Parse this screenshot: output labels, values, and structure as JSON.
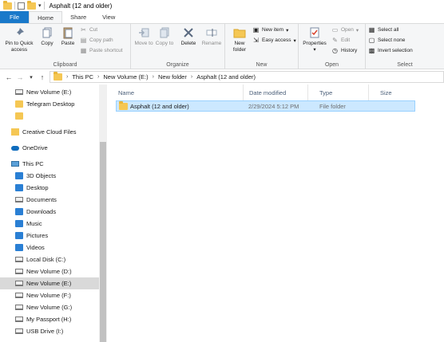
{
  "window": {
    "title": "Asphalt (12 and older)"
  },
  "tabs": [
    "File",
    "Home",
    "Share",
    "View"
  ],
  "ribbon": {
    "clipboard": {
      "label": "Clipboard",
      "pin": "Pin to Quick access",
      "copy": "Copy",
      "paste": "Paste",
      "cut": "Cut",
      "copy_path": "Copy path",
      "paste_shortcut": "Paste shortcut"
    },
    "organize": {
      "label": "Organize",
      "move_to": "Move to",
      "copy_to": "Copy to",
      "delete": "Delete",
      "rename": "Rename"
    },
    "new": {
      "label": "New",
      "new_folder": "New folder",
      "new_item": "New item",
      "easy_access": "Easy access"
    },
    "open": {
      "label": "Open",
      "properties": "Properties",
      "open": "Open",
      "edit": "Edit",
      "history": "History"
    },
    "select": {
      "label": "Select",
      "select_all": "Select all",
      "select_none": "Select none",
      "invert": "Invert selection"
    }
  },
  "address": {
    "crumbs": [
      "This PC",
      "New Volume (E:)",
      "New folder",
      "Asphalt (12 and older)"
    ]
  },
  "nav": {
    "items": [
      {
        "label": "New Volume (E:)",
        "icon": "drive-icon"
      },
      {
        "label": "Telegram Desktop",
        "icon": "folder-icon"
      },
      {
        "label": "",
        "icon": "folder-icon"
      },
      {
        "label": "Creative Cloud Files",
        "icon": "creative-cloud-icon"
      },
      {
        "label": "OneDrive",
        "icon": "cloud-icon"
      },
      {
        "label": "This PC",
        "icon": "computer-icon"
      },
      {
        "label": "3D Objects",
        "icon": "3d-objects-icon"
      },
      {
        "label": "Desktop",
        "icon": "desktop-icon"
      },
      {
        "label": "Documents",
        "icon": "documents-icon"
      },
      {
        "label": "Downloads",
        "icon": "downloads-icon"
      },
      {
        "label": "Music",
        "icon": "music-icon"
      },
      {
        "label": "Pictures",
        "icon": "pictures-icon"
      },
      {
        "label": "Videos",
        "icon": "videos-icon"
      },
      {
        "label": "Local Disk (C:)",
        "icon": "drive-icon"
      },
      {
        "label": "New Volume (D:)",
        "icon": "drive-icon"
      },
      {
        "label": "New Volume (E:)",
        "icon": "drive-icon"
      },
      {
        "label": "New Volume (F:)",
        "icon": "drive-icon"
      },
      {
        "label": "New Volume (G:)",
        "icon": "drive-icon"
      },
      {
        "label": "My Passport (H:)",
        "icon": "drive-icon"
      },
      {
        "label": "USB Drive (I:)",
        "icon": "drive-icon"
      }
    ]
  },
  "columns": [
    "Name",
    "Date modified",
    "Type",
    "Size"
  ],
  "files": [
    {
      "name": "Asphalt (12 and older)",
      "date": "2/29/2024 5:12 PM",
      "type": "File folder",
      "size": ""
    }
  ],
  "colors": {
    "accent": "#1979ca",
    "selection": "#cce8ff",
    "folder": "#f5c754"
  }
}
